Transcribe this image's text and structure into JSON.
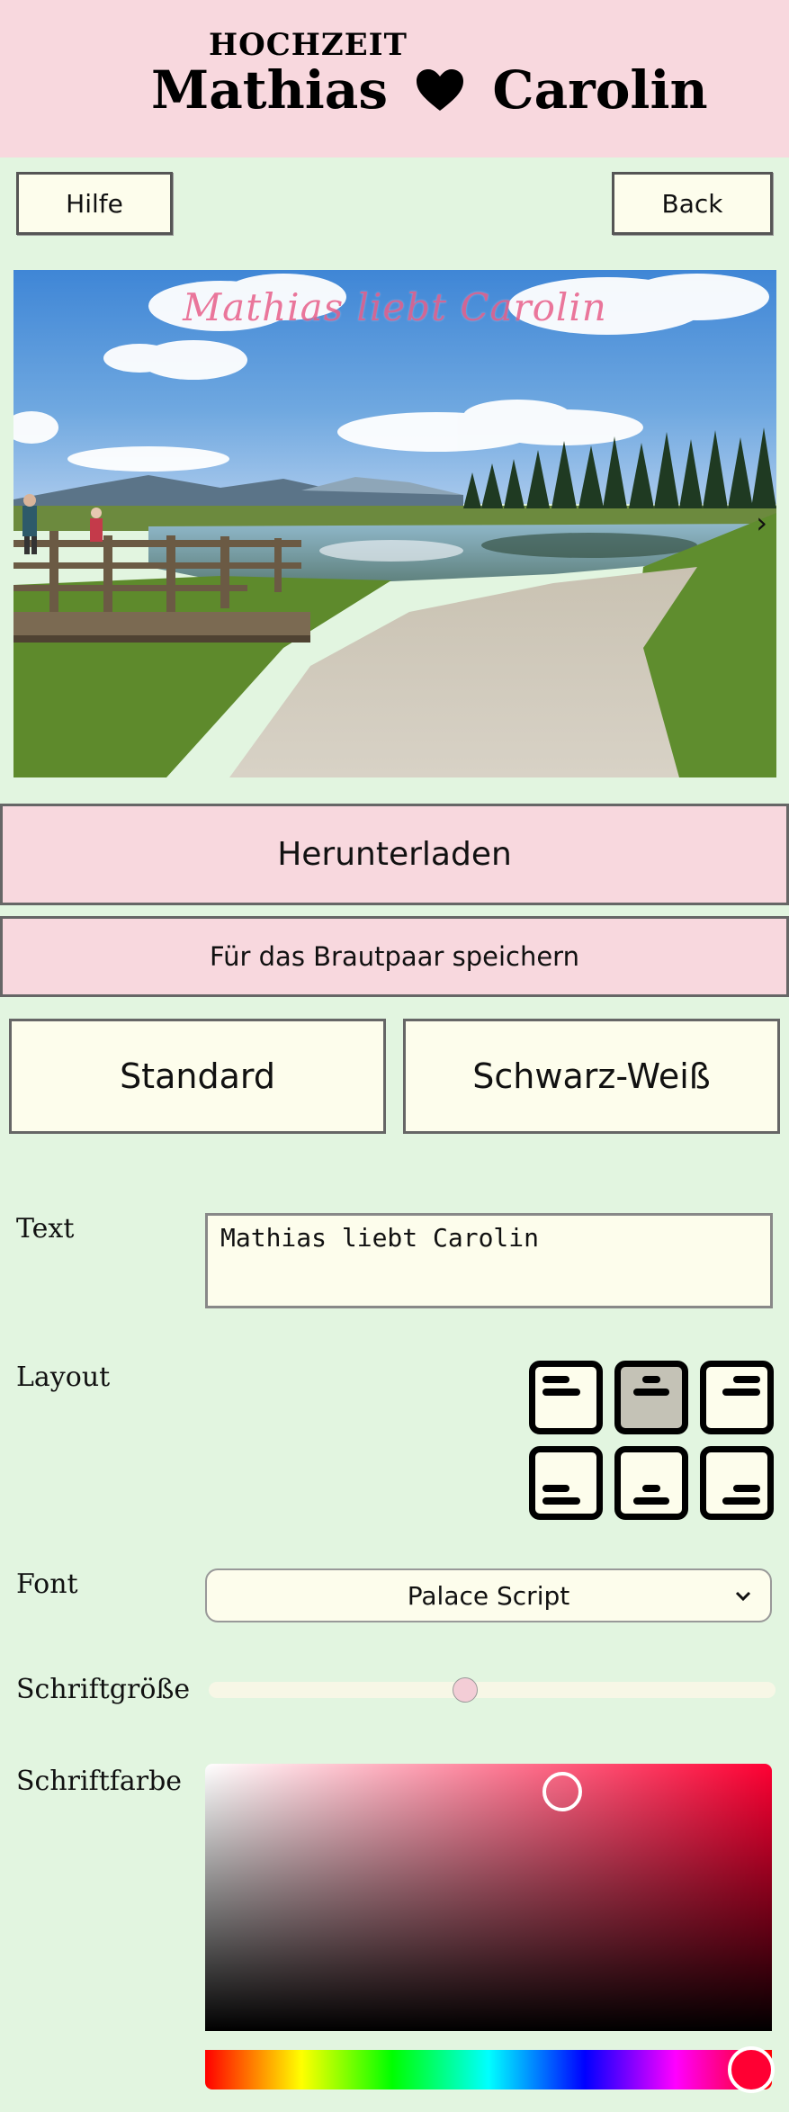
{
  "header": {
    "kicker": "HOCHZEIT",
    "name_left": "Mathias",
    "name_right": "Carolin",
    "heart_icon": "heart-icon",
    "background": "#f8d8de"
  },
  "nav": {
    "help_label": "Hilfe",
    "back_label": "Back"
  },
  "photo": {
    "overlay_text": "Mathias liebt Carolin",
    "next_icon": "chevron-right-icon",
    "next_glyph": "›"
  },
  "actions": {
    "download_label": "Herunterladen",
    "save_label": "Für das Brautpaar speichern"
  },
  "filters": {
    "standard_label": "Standard",
    "bw_label": "Schwarz-Weiß"
  },
  "form": {
    "text_label": "Text",
    "text_value": "Mathias liebt Carolin",
    "layout_label": "Layout",
    "layout_selected": "top-center",
    "layout_options": [
      "top-left",
      "top-center",
      "top-right",
      "bottom-left",
      "bottom-center",
      "bottom-right"
    ],
    "font_label": "Font",
    "font_value": "Palace Script",
    "font_size_label": "Schriftgröße",
    "font_size_level": 0.45,
    "font_color_label": "Schriftfarbe",
    "font_color_value": "#e8608a",
    "hue_value": "#ff0033"
  },
  "colors": {
    "page_bg": "#e2f5e0",
    "button_bg": "#fdfdec",
    "accent_pink": "#f8d8de"
  }
}
